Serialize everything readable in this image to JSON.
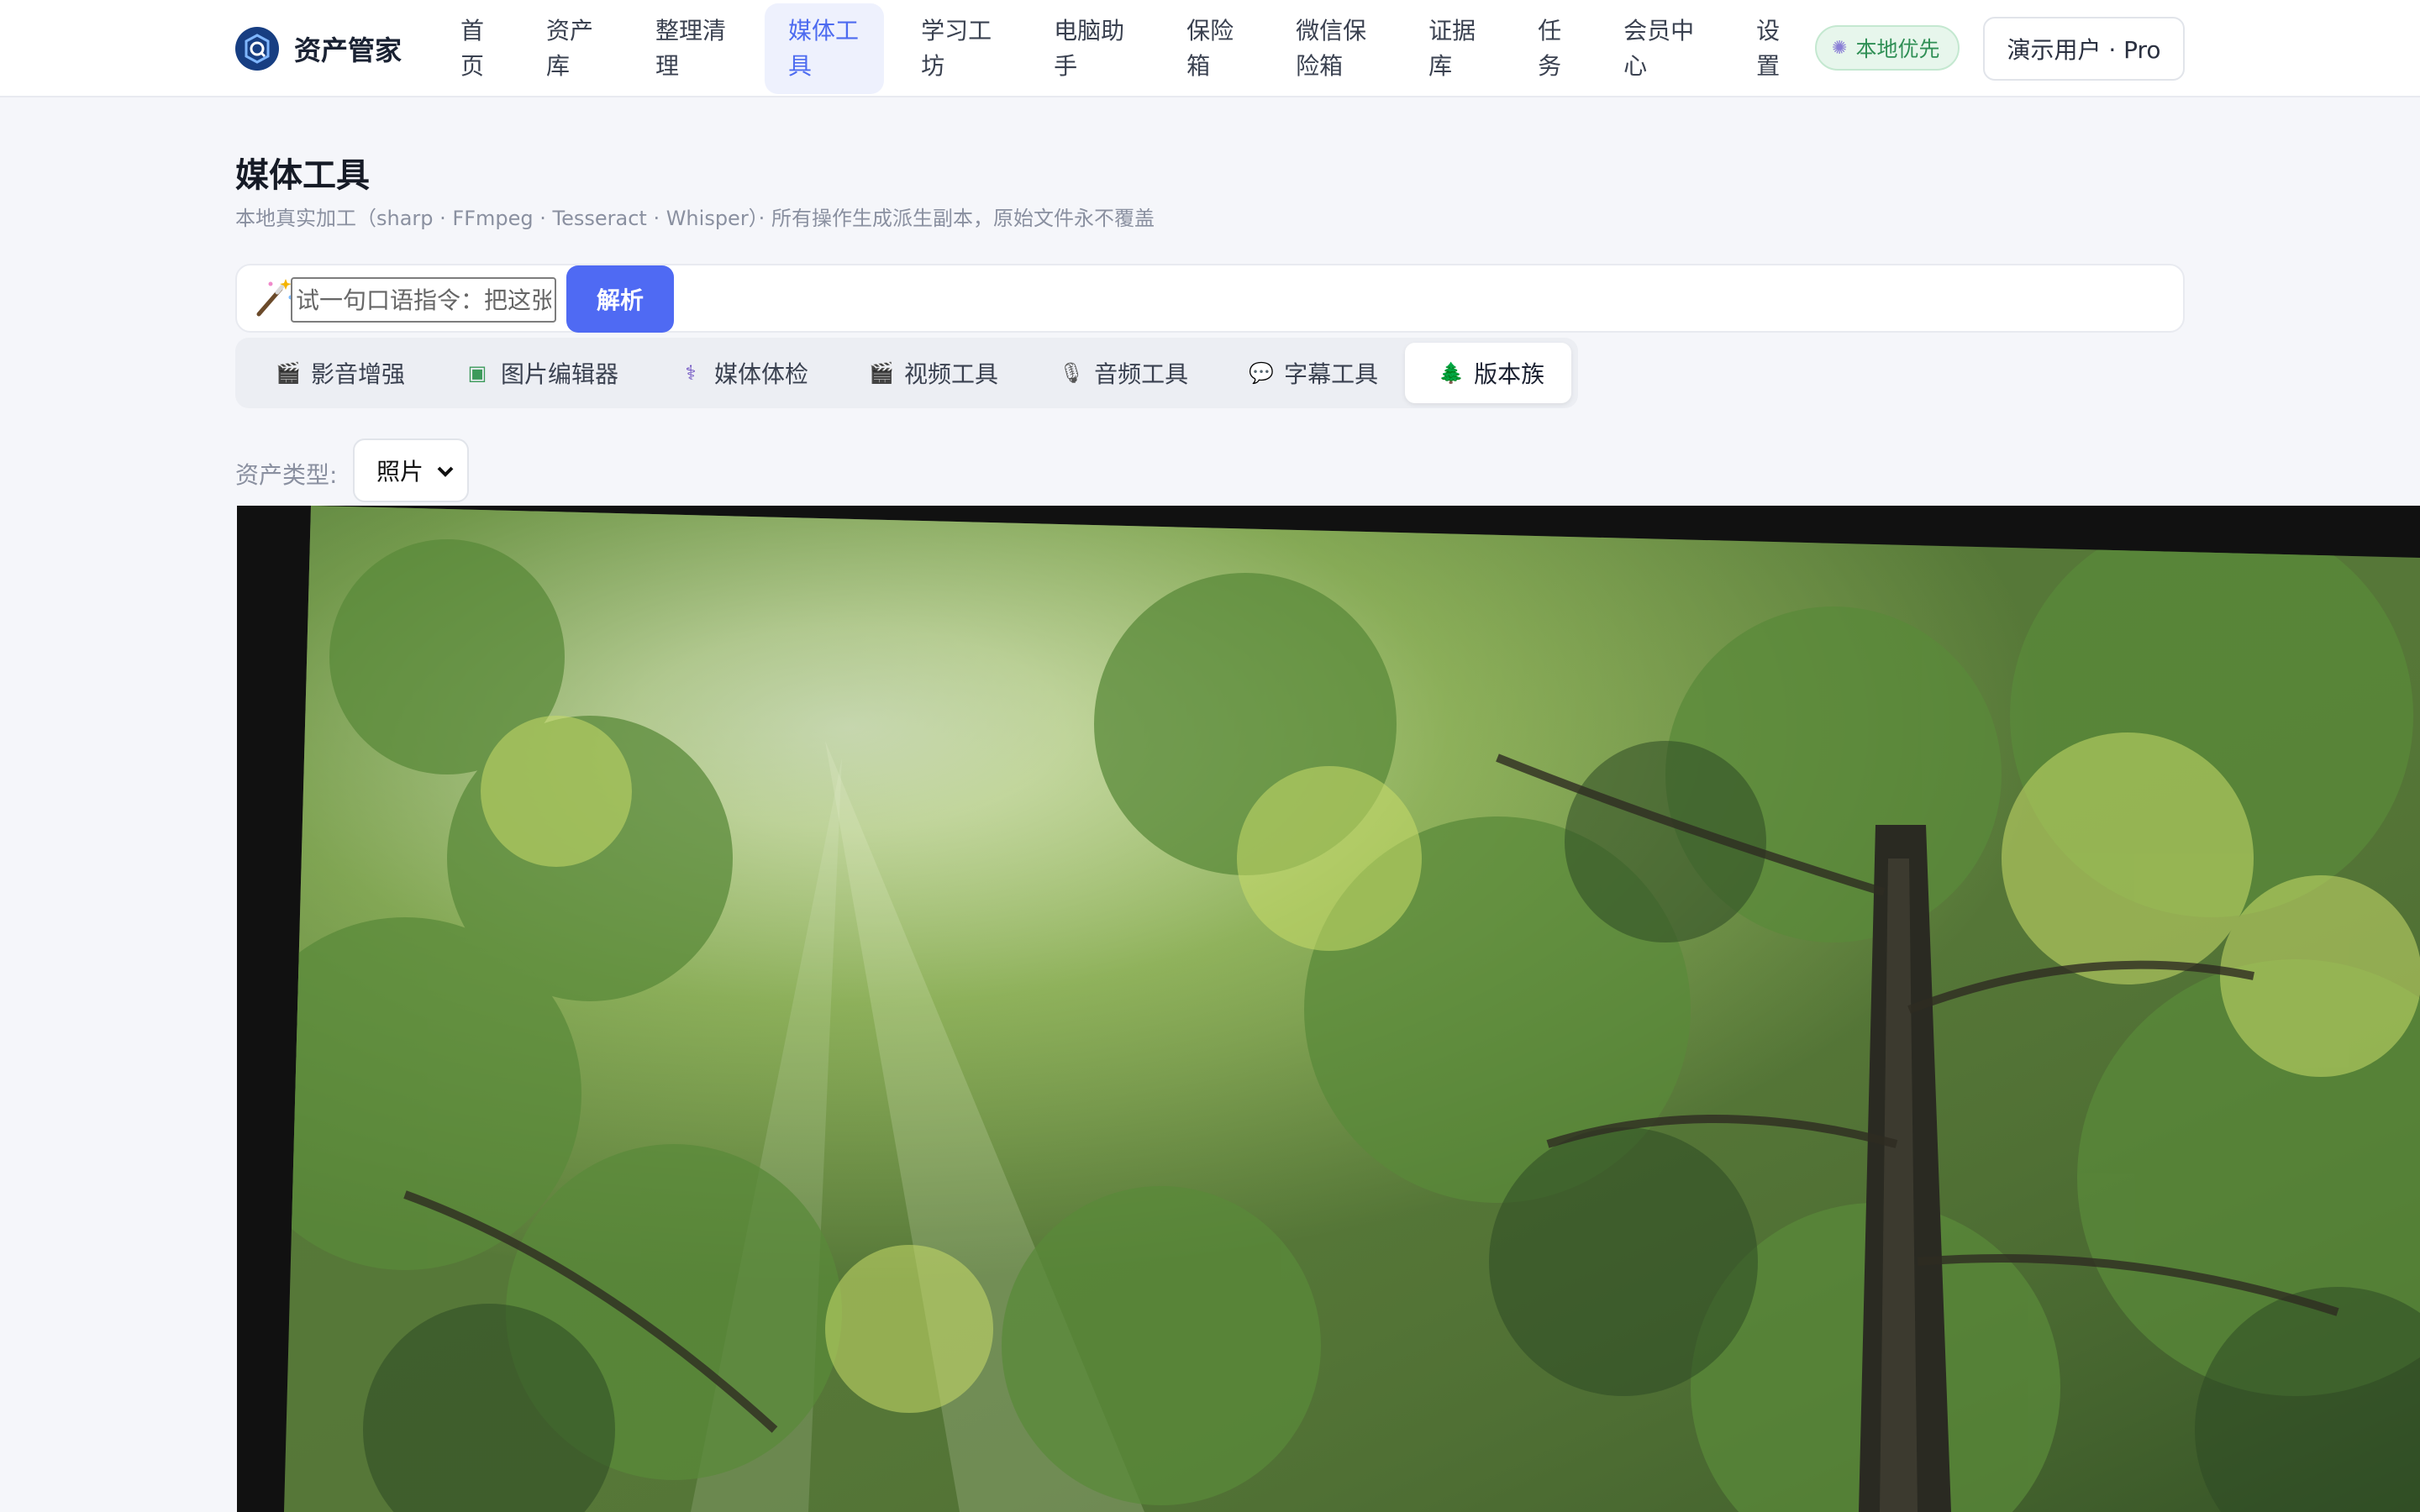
{
  "app": {
    "name": "资产管家"
  },
  "nav": {
    "items": [
      {
        "lines": [
          "首",
          "页"
        ],
        "active": false
      },
      {
        "lines": [
          "资产",
          "库"
        ],
        "active": false
      },
      {
        "lines": [
          "整理清",
          "理"
        ],
        "active": false
      },
      {
        "lines": [
          "媒体工",
          "具"
        ],
        "active": true
      },
      {
        "lines": [
          "学习工",
          "坊"
        ],
        "active": false
      },
      {
        "lines": [
          "电脑助",
          "手"
        ],
        "active": false
      },
      {
        "lines": [
          "保险",
          "箱"
        ],
        "active": false
      },
      {
        "lines": [
          "微信保",
          "险箱"
        ],
        "active": false
      },
      {
        "lines": [
          "证据",
          "库"
        ],
        "active": false
      },
      {
        "lines": [
          "任",
          "务"
        ],
        "active": false
      },
      {
        "lines": [
          "会员中",
          "心"
        ],
        "active": false
      },
      {
        "lines": [
          "设",
          "置"
        ],
        "active": false
      }
    ],
    "badge": "本地优先",
    "user": "演示用户 · Pro"
  },
  "page": {
    "title": "媒体工具",
    "subtitle": "本地真实加工（sharp · FFmpeg · Tesseract · Whisper）· 所有操作生成派生副本，原始文件永不覆盖"
  },
  "command": {
    "placeholder": "试一句口语指令：把这张",
    "button": "解析"
  },
  "tabs": [
    {
      "label": "影音增强",
      "icon": "clapper-icon",
      "active": false
    },
    {
      "label": "图片编辑器",
      "icon": "picture-icon",
      "active": false
    },
    {
      "label": "媒体体检",
      "icon": "stethoscope-icon",
      "active": false
    },
    {
      "label": "视频工具",
      "icon": "clapper-icon",
      "active": false
    },
    {
      "label": "音频工具",
      "icon": "microphone-icon",
      "active": false
    },
    {
      "label": "字幕工具",
      "icon": "speech-bubble-icon",
      "active": false
    },
    {
      "label": "版本族",
      "icon": "tree-icon",
      "active": true
    }
  ],
  "asset_type": {
    "label": "资产类型:",
    "value": "照片"
  },
  "colors": {
    "accent": "#4f6af3",
    "active_nav_bg": "#eef1fd",
    "badge_green": "#2f8f55"
  }
}
